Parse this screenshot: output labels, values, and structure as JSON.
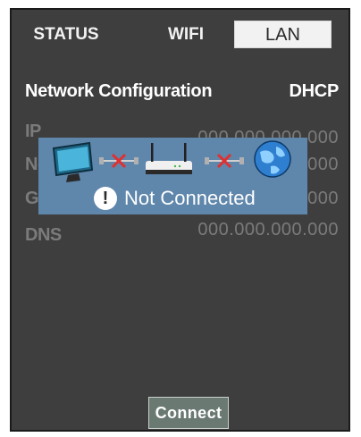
{
  "tabs": {
    "status": "STATUS",
    "wifi": "WIFI",
    "lan": "LAN"
  },
  "network": {
    "title": "Network Configuration",
    "mode": "DHCP",
    "rows": [
      {
        "label": "IP",
        "value": "000.000.000.000"
      },
      {
        "label": "Netmask",
        "value": "000.000.000.000"
      },
      {
        "label": "Gateway",
        "value": "000.000.000.000"
      },
      {
        "label": "DNS",
        "value": "000.000.000.000"
      }
    ]
  },
  "status_overlay": {
    "message": "Not Connected",
    "exclamation": "!",
    "icons": [
      "monitor-icon",
      "disconnected-icon",
      "router-icon",
      "disconnected-icon",
      "globe-icon"
    ]
  },
  "buttons": {
    "connect": "Connect"
  },
  "colors": {
    "panel": "#3e3e3e",
    "overlay": "#5f86ab",
    "active_tab": "#f2f2f2",
    "disconnect_x": "#e03030",
    "connect_button": "#6a7a73"
  }
}
